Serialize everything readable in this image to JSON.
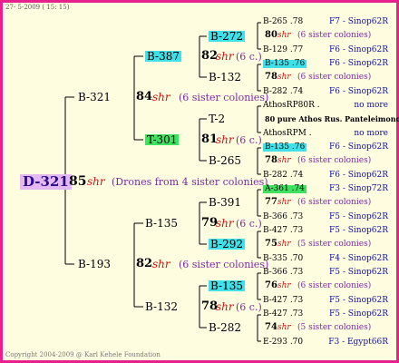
{
  "date": "27-  5-2009  ( 15: 15)",
  "copyright": "Copyright 2004-2009 @ Karl Kehele Foundation",
  "root": {
    "label": "D-321",
    "num": "85",
    "shr": "shr",
    "note": "(Drones from 4 sister colonies)"
  },
  "gen1": {
    "top": {
      "label": "B-321",
      "num": "84",
      "shr": "shr",
      "note": "(6 sister colonies)"
    },
    "bottom": {
      "label": "B-193",
      "num": "82",
      "shr": "shr",
      "note": "(6 sister colonies)"
    }
  },
  "gen2": [
    {
      "label": "B-387",
      "num": "82",
      "shr": "shr",
      "note": "(6 c.)"
    },
    {
      "label": "T-301",
      "num": "81",
      "shr": "shr",
      "note": "(6 c.)"
    },
    {
      "label": "B-135",
      "num": "79",
      "shr": "shr",
      "note": "(6 c.)"
    },
    {
      "label": "B-132",
      "num": "78",
      "shr": "shr",
      "note": "(6 c.)"
    }
  ],
  "gen3": [
    "B-272",
    "B-132",
    "T-2",
    "B-265",
    "B-391",
    "B-292",
    "B-135",
    "B-282"
  ],
  "leaves": [
    {
      "a": "B-265 .78",
      "code": "F7 - Sinop62R"
    },
    {
      "mid": {
        "num": "80",
        "shr": "shr",
        "note": "(6 sister colonies)"
      }
    },
    {
      "a": "B-129 .77",
      "code": "F6 - Sinop62R"
    },
    {
      "a": "B-135 .76",
      "code": "F6 - Sinop62R"
    },
    {
      "mid": {
        "num": "78",
        "shr": "shr",
        "note": "(6 sister colonies)"
      }
    },
    {
      "a": "B-282 .74",
      "code": "F6 - Sinop62R"
    },
    {
      "a": "AthosRP80R .",
      "code": "no more"
    },
    {
      "mid2": "80 pure Athos Rus. Panteleimonos"
    },
    {
      "a": "AthosRPM .",
      "code": "no more"
    },
    {
      "a": "B-135 .76",
      "code": "F6 - Sinop62R"
    },
    {
      "mid": {
        "num": "78",
        "shr": "shr",
        "note": "(6 sister colonies)"
      }
    },
    {
      "a": "B-282 .74",
      "code": "F6 - Sinop62R"
    },
    {
      "a": "A-361 .74",
      "code": "F3 - Sinop72R"
    },
    {
      "mid": {
        "num": "77",
        "shr": "shr",
        "note": "(6 sister colonies)"
      }
    },
    {
      "a": "B-366 .73",
      "code": "F5 - Sinop62R"
    },
    {
      "a": "B-427 .73",
      "code": "F5 - Sinop62R"
    },
    {
      "mid": {
        "num": "75",
        "shr": "shr",
        "note": "(5 sister colonies)"
      }
    },
    {
      "a": "B-335 .70",
      "code": "F4 - Sinop62R"
    },
    {
      "a": "B-366 .73",
      "code": "F5 - Sinop62R"
    },
    {
      "mid": {
        "num": "76",
        "shr": "shr",
        "note": "(6 sister colonies)"
      }
    },
    {
      "a": "B-427 .73",
      "code": "F5 - Sinop62R"
    },
    {
      "a": "B-427 .73",
      "code": "F5 - Sinop62R"
    },
    {
      "mid": {
        "num": "74",
        "shr": "shr",
        "note": "(5 sister colonies)"
      }
    },
    {
      "a": "E-293 .70",
      "code": "F3 - Egypt66R"
    }
  ],
  "colors": {
    "border": "#e8208c",
    "highlight_cyan": "#40e0e8",
    "highlight_green": "#40e060",
    "shr": "#d01010"
  }
}
